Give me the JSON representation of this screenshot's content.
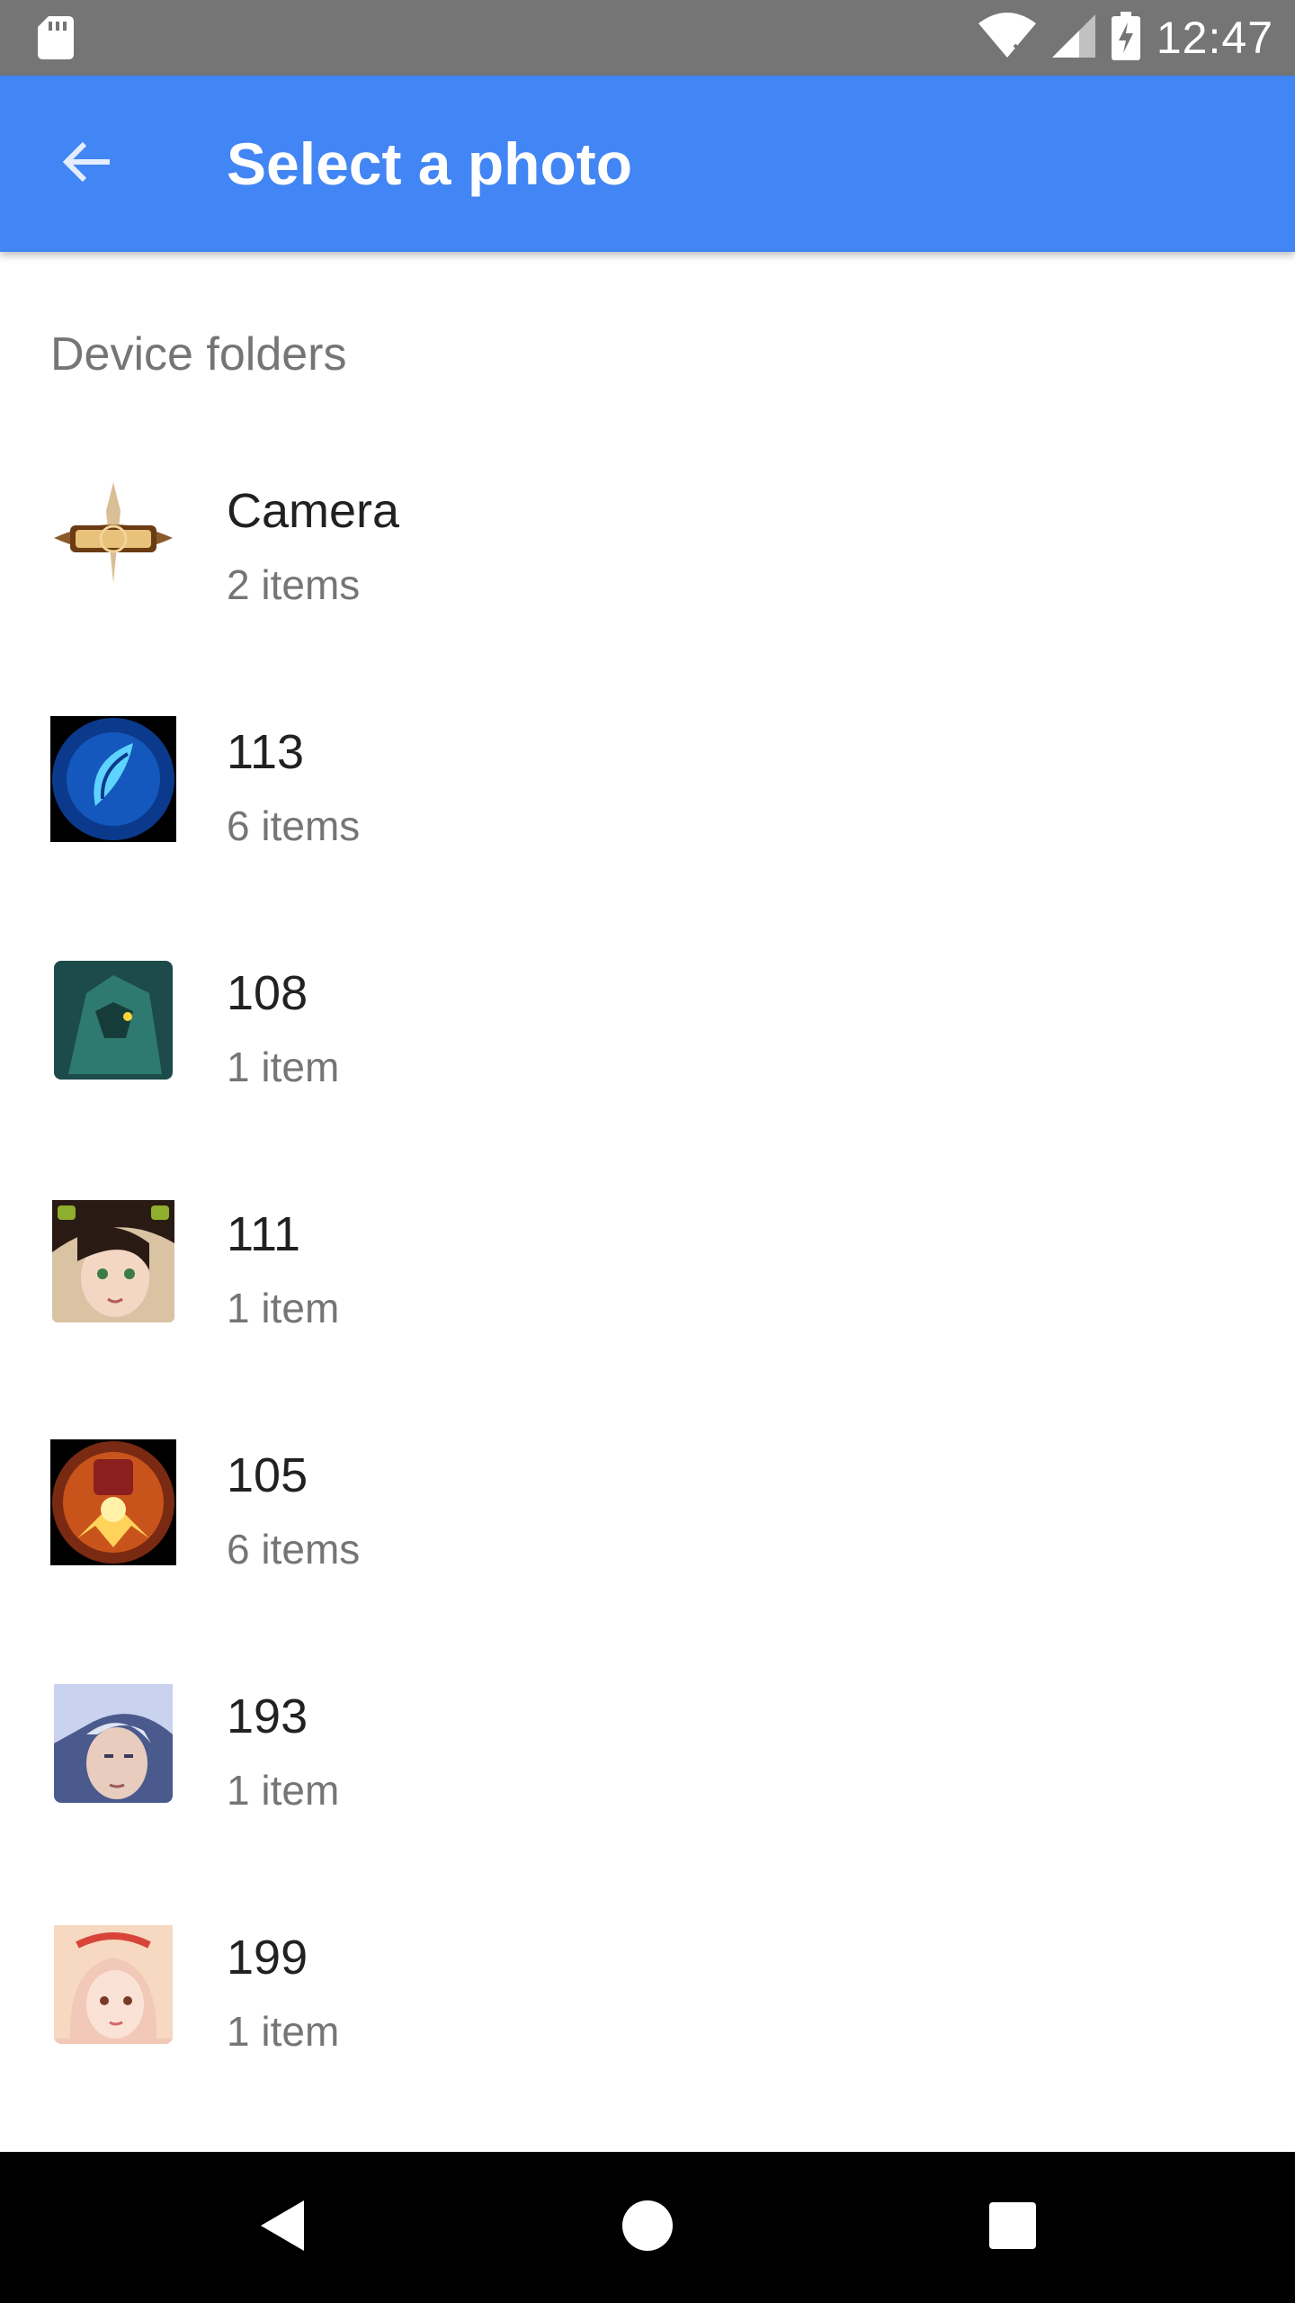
{
  "status_bar": {
    "time": "12:47",
    "icons": [
      "sd-card-icon",
      "wifi-icon",
      "cell-signal-icon",
      "battery-charging-icon"
    ]
  },
  "app_bar": {
    "title": "Select a photo",
    "back_icon": "arrow-back-icon",
    "color": "#4285f4"
  },
  "section": {
    "header": "Device folders"
  },
  "folders": [
    {
      "name": "Camera",
      "count": "2 items"
    },
    {
      "name": "113",
      "count": "6 items"
    },
    {
      "name": "108",
      "count": "1 item"
    },
    {
      "name": "111",
      "count": "1 item"
    },
    {
      "name": "105",
      "count": "6 items"
    },
    {
      "name": "193",
      "count": "1 item"
    },
    {
      "name": "199",
      "count": "1 item"
    }
  ],
  "nav_bar": {
    "buttons": [
      "back-triangle-icon",
      "home-circle-icon",
      "recents-square-icon"
    ]
  }
}
